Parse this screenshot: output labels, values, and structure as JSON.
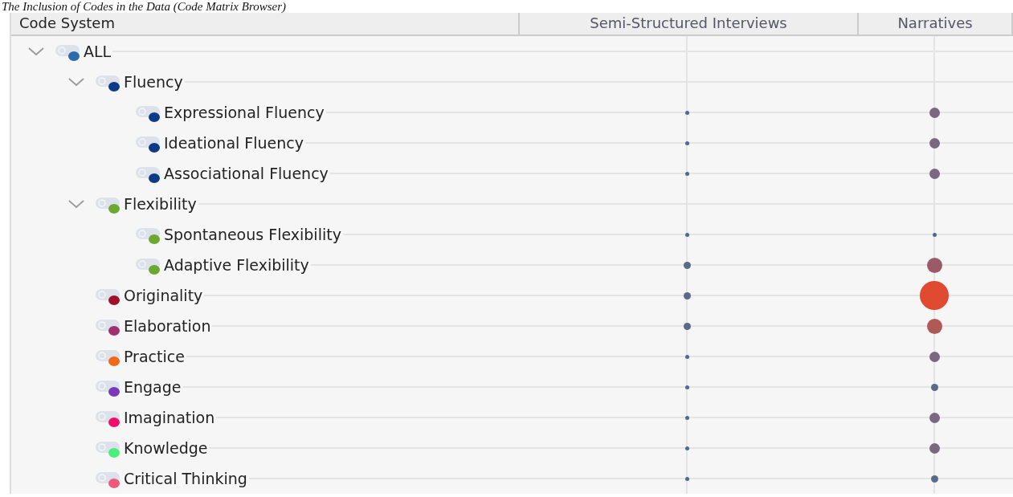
{
  "caption": "The Inclusion of Codes in the Data (Code Matrix Browser)",
  "table": {
    "columns": [
      "Code System",
      "Semi-Structured Interviews",
      "Narratives"
    ],
    "tree": [
      {
        "label": "ALL",
        "color": "#2a6aad",
        "expanded": true,
        "children": [
          {
            "label": "Fluency",
            "color": "#0c3a88",
            "expanded": true,
            "children": [
              {
                "label": "Expressional Fluency",
                "color": "#0c3a88",
                "cells": [
                  {
                    "kind": "tiny",
                    "color": "#4a6a9a"
                  },
                  {
                    "kind": "medium",
                    "color": "#7a6880"
                  }
                ]
              },
              {
                "label": "Ideational Fluency",
                "color": "#0c3a88",
                "cells": [
                  {
                    "kind": "tiny",
                    "color": "#4a6a9a"
                  },
                  {
                    "kind": "medium",
                    "color": "#7a6880"
                  }
                ]
              },
              {
                "label": "Associational Fluency",
                "color": "#0c3a88",
                "cells": [
                  {
                    "kind": "tiny",
                    "color": "#4a6a9a"
                  },
                  {
                    "kind": "medium",
                    "color": "#7a6880"
                  }
                ]
              }
            ]
          },
          {
            "label": "Flexibility",
            "color": "#6aa832",
            "expanded": true,
            "children": [
              {
                "label": "Spontaneous Flexibility",
                "color": "#6aa832",
                "cells": [
                  {
                    "kind": "tiny",
                    "color": "#4a6a9a"
                  },
                  {
                    "kind": "tiny",
                    "color": "#4a6a9a"
                  }
                ]
              },
              {
                "label": "Adaptive Flexibility",
                "color": "#6aa832",
                "cells": [
                  {
                    "kind": "small",
                    "color": "#5a6a8a"
                  },
                  {
                    "kind": "large",
                    "color": "#9a5a68"
                  }
                ]
              }
            ]
          },
          {
            "label": "Originality",
            "color": "#a0102a",
            "cells": [
              {
                "kind": "small",
                "color": "#5a6a8a"
              },
              {
                "kind": "huge",
                "color": "#e04a30"
              }
            ]
          },
          {
            "label": "Elaboration",
            "color": "#a03070",
            "cells": [
              {
                "kind": "small",
                "color": "#5a6a8a"
              },
              {
                "kind": "large",
                "color": "#b05a58"
              }
            ]
          },
          {
            "label": "Practice",
            "color": "#f0681a",
            "cells": [
              {
                "kind": "tiny",
                "color": "#4a6a9a"
              },
              {
                "kind": "medium",
                "color": "#7a6880"
              }
            ]
          },
          {
            "label": "Engage",
            "color": "#7a3ab8",
            "cells": [
              {
                "kind": "tiny",
                "color": "#4a6a9a"
              },
              {
                "kind": "small",
                "color": "#5a6a8a"
              }
            ]
          },
          {
            "label": "Imagination",
            "color": "#f0106a",
            "cells": [
              {
                "kind": "tiny",
                "color": "#4a6a9a"
              },
              {
                "kind": "medium",
                "color": "#7a6880"
              }
            ]
          },
          {
            "label": "Knowledge",
            "color": "#4aee7a",
            "cells": [
              {
                "kind": "tiny",
                "color": "#4a6a9a"
              },
              {
                "kind": "medium",
                "color": "#7a6880"
              }
            ]
          },
          {
            "label": "Critical Thinking",
            "color": "#f05a78",
            "cells": [
              {
                "kind": "tiny",
                "color": "#4a6a9a"
              },
              {
                "kind": "small",
                "color": "#5a6a8a"
              }
            ]
          }
        ]
      }
    ]
  }
}
